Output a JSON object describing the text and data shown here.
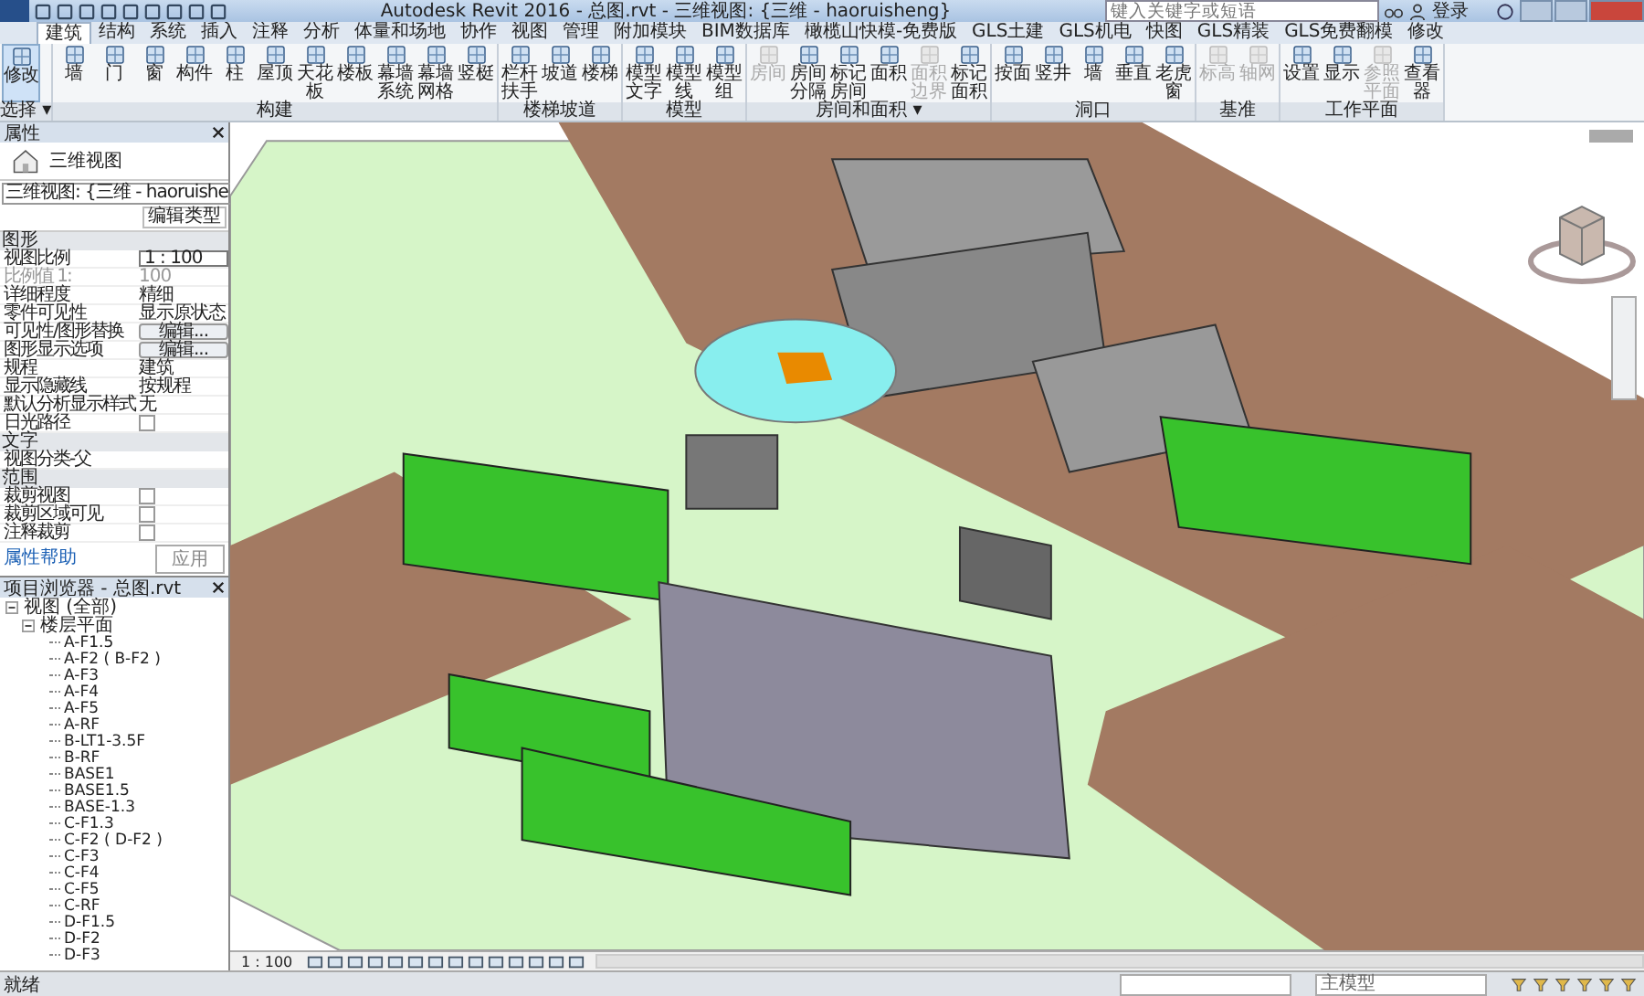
{
  "window": {
    "title": "Autodesk Revit 2016 -   总图.rvt - 三维视图: {三维 - haoruisheng}",
    "search_placeholder": "键入关键字或短语",
    "user": "登录"
  },
  "tabs": [
    {
      "label": "建筑",
      "selected": true
    },
    {
      "label": "结构",
      "selected": false
    },
    {
      "label": "系统",
      "selected": false
    },
    {
      "label": "插入",
      "selected": false
    },
    {
      "label": "注释",
      "selected": false
    },
    {
      "label": "分析",
      "selected": false
    },
    {
      "label": "体量和场地",
      "selected": false
    },
    {
      "label": "协作",
      "selected": false
    },
    {
      "label": "视图",
      "selected": false
    },
    {
      "label": "管理",
      "selected": false
    },
    {
      "label": "附加模块",
      "selected": false
    },
    {
      "label": "BIM数据库",
      "selected": false
    },
    {
      "label": "橄榄山快模-免费版",
      "selected": false
    },
    {
      "label": "GLS土建",
      "selected": false
    },
    {
      "label": "GLS机电",
      "selected": false
    },
    {
      "label": "快图",
      "selected": false
    },
    {
      "label": "GLS精装",
      "selected": false
    },
    {
      "label": "GLS免费翻模",
      "selected": false
    },
    {
      "label": "修改",
      "selected": false
    }
  ],
  "ribbon_panels": [
    {
      "label": "选择 ▾",
      "tools": [
        {
          "label": "修改",
          "disabled": false,
          "selected": true
        }
      ]
    },
    {
      "label": "构建",
      "tools": [
        {
          "label": "墙",
          "disabled": false,
          "selected": false
        },
        {
          "label": "门",
          "disabled": false,
          "selected": false
        },
        {
          "label": "窗",
          "disabled": false,
          "selected": false
        },
        {
          "label": "构件",
          "disabled": false,
          "selected": false
        },
        {
          "label": "柱",
          "disabled": false,
          "selected": false
        },
        {
          "label": "屋顶",
          "disabled": false,
          "selected": false
        },
        {
          "label": "天花板",
          "disabled": false,
          "selected": false
        },
        {
          "label": "楼板",
          "disabled": false,
          "selected": false
        },
        {
          "label": "幕墙系统",
          "disabled": false,
          "selected": false
        },
        {
          "label": "幕墙网格",
          "disabled": false,
          "selected": false
        },
        {
          "label": "竖梃",
          "disabled": false,
          "selected": false
        }
      ]
    },
    {
      "label": "楼梯坡道",
      "tools": [
        {
          "label": "栏杆扶手",
          "disabled": false,
          "selected": false
        },
        {
          "label": "坡道",
          "disabled": false,
          "selected": false
        },
        {
          "label": "楼梯",
          "disabled": false,
          "selected": false
        }
      ]
    },
    {
      "label": "模型",
      "tools": [
        {
          "label": "模型文字",
          "disabled": false,
          "selected": false
        },
        {
          "label": "模型线",
          "disabled": false,
          "selected": false
        },
        {
          "label": "模型组",
          "disabled": false,
          "selected": false
        }
      ]
    },
    {
      "label": "房间和面积 ▾",
      "tools": [
        {
          "label": "房间",
          "disabled": true,
          "selected": false
        },
        {
          "label": "房间分隔",
          "disabled": false,
          "selected": false
        },
        {
          "label": "标记房间",
          "disabled": false,
          "selected": false
        },
        {
          "label": "面积",
          "disabled": false,
          "selected": false
        },
        {
          "label": "面积边界",
          "disabled": true,
          "selected": false
        },
        {
          "label": "标记面积",
          "disabled": false,
          "selected": false
        }
      ]
    },
    {
      "label": "洞口",
      "tools": [
        {
          "label": "按面",
          "disabled": false,
          "selected": false
        },
        {
          "label": "竖井",
          "disabled": false,
          "selected": false
        },
        {
          "label": "墙",
          "disabled": false,
          "selected": false
        },
        {
          "label": "垂直",
          "disabled": false,
          "selected": false
        },
        {
          "label": "老虎窗",
          "disabled": false,
          "selected": false
        }
      ]
    },
    {
      "label": "基准",
      "tools": [
        {
          "label": "标高",
          "disabled": true,
          "selected": false
        },
        {
          "label": "轴网",
          "disabled": true,
          "selected": false
        }
      ]
    },
    {
      "label": "工作平面",
      "tools": [
        {
          "label": "设置",
          "disabled": false,
          "selected": false
        },
        {
          "label": "显示",
          "disabled": false,
          "selected": false
        },
        {
          "label": "参照平面",
          "disabled": true,
          "selected": false
        },
        {
          "label": "查看器",
          "disabled": false,
          "selected": false
        }
      ]
    }
  ],
  "properties": {
    "title": "属性",
    "type_name": "三维视图",
    "selector": "三维视图: {三维 - haoruishe",
    "edit_type": "编辑类型",
    "help": "属性帮助",
    "apply": "应用",
    "groups": [
      {
        "title": "图形",
        "rows": [
          {
            "kind": "input",
            "label": "视图比例",
            "value": "1 : 100",
            "disabled": false
          },
          {
            "kind": "text",
            "label": "比例值 1:",
            "value": "100",
            "disabled": true
          },
          {
            "kind": "text",
            "label": "详细程度",
            "value": "精细",
            "disabled": false
          },
          {
            "kind": "text",
            "label": "零件可见性",
            "value": "显示原状态",
            "disabled": false
          },
          {
            "kind": "button",
            "label": "可见性/图形替换",
            "value": "编辑...",
            "disabled": false
          },
          {
            "kind": "button",
            "label": "图形显示选项",
            "value": "编辑...",
            "disabled": false
          },
          {
            "kind": "text",
            "label": "规程",
            "value": "建筑",
            "disabled": false
          },
          {
            "kind": "text",
            "label": "显示隐藏线",
            "value": "按规程",
            "disabled": false
          },
          {
            "kind": "text",
            "label": "默认分析显示样式",
            "value": "无",
            "disabled": false
          },
          {
            "kind": "check",
            "label": "日光路径",
            "checked": false,
            "disabled": false
          }
        ]
      },
      {
        "title": "文字",
        "rows": [
          {
            "kind": "text",
            "label": "视图分类-父",
            "value": "",
            "disabled": false
          }
        ]
      },
      {
        "title": "范围",
        "rows": [
          {
            "kind": "check",
            "label": "裁剪视图",
            "checked": false,
            "disabled": false
          },
          {
            "kind": "check",
            "label": "裁剪区域可见",
            "checked": false,
            "disabled": false
          },
          {
            "kind": "check",
            "label": "注释裁剪",
            "checked": false,
            "disabled": false
          }
        ]
      }
    ]
  },
  "project_browser": {
    "title": "项目浏览器 - 总图.rvt",
    "tree": [
      {
        "label": "视图 (全部)",
        "expanded": true,
        "children": [
          {
            "label": "楼层平面",
            "expanded": true,
            "children": [
              {
                "label": "A-F1.5"
              },
              {
                "label": "A-F2 ( B-F2 )"
              },
              {
                "label": "A-F3"
              },
              {
                "label": "A-F4"
              },
              {
                "label": "A-F5"
              },
              {
                "label": "A-RF"
              },
              {
                "label": "B-LT1-3.5F"
              },
              {
                "label": "B-RF"
              },
              {
                "label": "BASE1"
              },
              {
                "label": "BASE1.5"
              },
              {
                "label": "BASE-1.3"
              },
              {
                "label": "C-F1.3"
              },
              {
                "label": "C-F2 ( D-F2 )"
              },
              {
                "label": "C-F3"
              },
              {
                "label": "C-F4"
              },
              {
                "label": "C-F5"
              },
              {
                "label": "C-RF"
              },
              {
                "label": "D-F1.5"
              },
              {
                "label": "D-F2"
              },
              {
                "label": "D-F3"
              }
            ]
          }
        ]
      }
    ]
  },
  "view_bar": {
    "scale": "1 : 100"
  },
  "status_bar": {
    "message": "就绪",
    "workset": "主模型"
  }
}
